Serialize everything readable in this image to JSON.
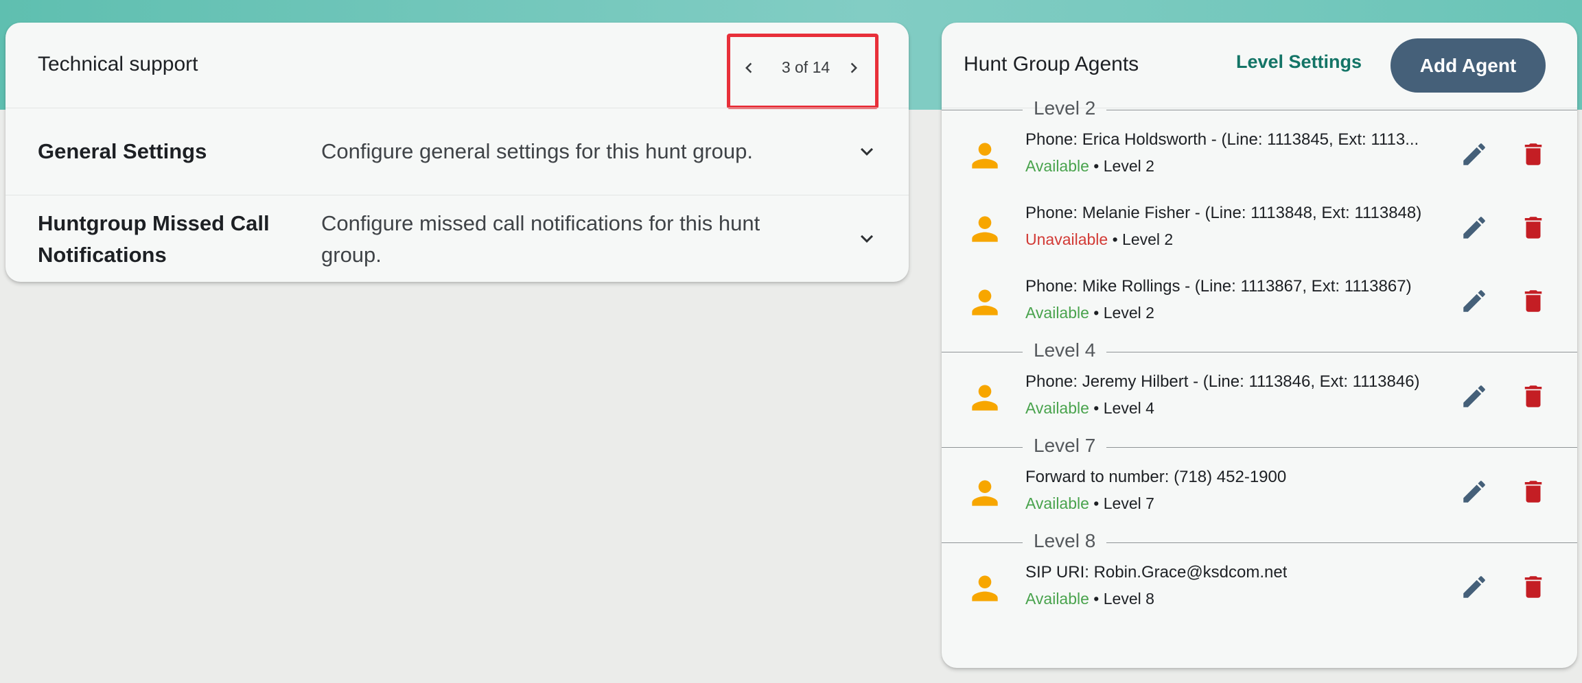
{
  "left_panel": {
    "title": "Technical support",
    "pager": {
      "text": "3 of 14",
      "prev_icon": "chevron-left-icon",
      "next_icon": "chevron-right-icon"
    },
    "sections": [
      {
        "title_lines": [
          "General Settings"
        ],
        "desc_lines": [
          "Configure general settings for this hunt group."
        ]
      },
      {
        "title_lines": [
          "Huntgroup Missed Call",
          "Notifications"
        ],
        "desc_lines": [
          "Configure missed call notifications for this hunt",
          "group."
        ]
      }
    ]
  },
  "right_panel": {
    "title": "Hunt Group Agents",
    "level_settings_label": "Level Settings",
    "add_agent_label": "Add Agent",
    "groups": [
      {
        "level_label": "Level 2",
        "agents": [
          {
            "name": "Phone: Erica Holdsworth - (Line: 1113845, Ext: 1113...",
            "status": "Available",
            "level_text": "Level 2"
          },
          {
            "name": "Phone: Melanie Fisher - (Line: 1113848, Ext: 1113848)",
            "status": "Unavailable",
            "level_text": "Level 2"
          },
          {
            "name": "Phone: Mike Rollings - (Line: 1113867, Ext: 1113867)",
            "status": "Available",
            "level_text": "Level 2"
          }
        ]
      },
      {
        "level_label": "Level 4",
        "agents": [
          {
            "name": "Phone: Jeremy Hilbert - (Line: 1113846, Ext: 1113846)",
            "status": "Available",
            "level_text": "Level 4"
          }
        ]
      },
      {
        "level_label": "Level 7",
        "agents": [
          {
            "name": "Forward to number: (718) 452-1900",
            "status": "Available",
            "level_text": "Level 7"
          }
        ]
      },
      {
        "level_label": "Level 8",
        "agents": [
          {
            "name": "SIP URI: Robin.Grace@ksdcom.net",
            "status": "Available",
            "level_text": "Level 8"
          }
        ]
      }
    ],
    "separator_dot": "•"
  },
  "colors": {
    "accent_teal": "#137466",
    "button_slate": "#456079",
    "available_green": "#49a34d",
    "unavailable_red": "#d23a35",
    "avatar_orange": "#f7a600",
    "edit_icon": "#456079",
    "delete_icon": "#c41e24",
    "highlight_red": "#e8303a"
  },
  "icons": {
    "avatar": "person-icon",
    "edit": "pencil-icon",
    "delete": "trash-icon",
    "expand": "chevron-down-icon"
  }
}
